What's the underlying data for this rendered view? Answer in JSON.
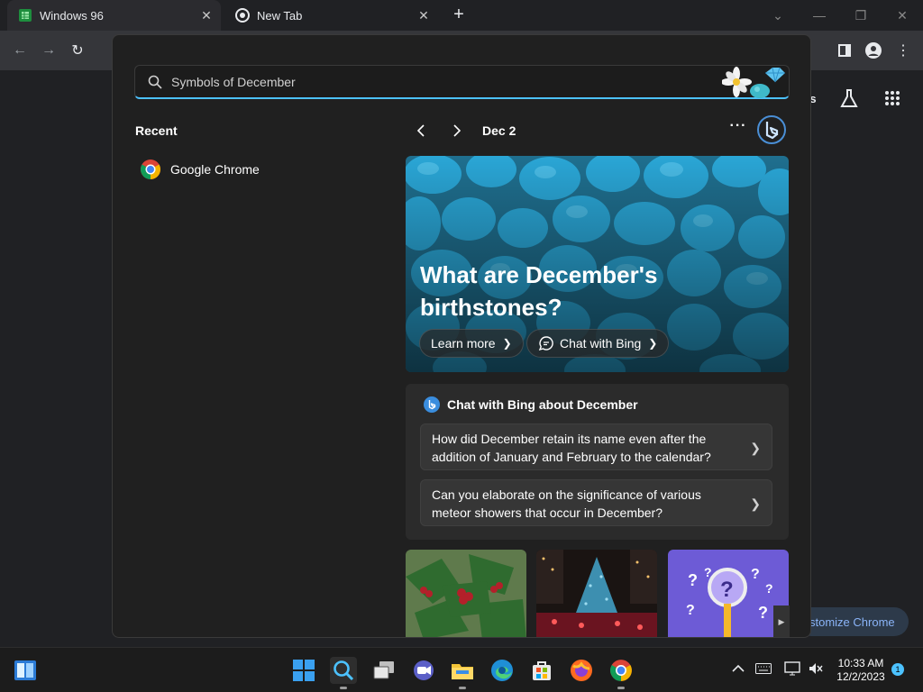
{
  "browser": {
    "tabs": [
      {
        "label": "Windows 96",
        "icon": "sheet-icon"
      },
      {
        "label": "New Tab",
        "icon": "chrome-icon"
      }
    ],
    "new_tab": "+"
  },
  "page": {
    "customize_label": "stomize Chrome",
    "right_text": "s"
  },
  "search": {
    "value": "Symbols of December",
    "recent_heading": "Recent",
    "recent_items": [
      {
        "label": "Google Chrome"
      }
    ],
    "date_label": "Dec 2",
    "more_label": "···",
    "hero": {
      "title": "What are December's birthstones?",
      "learn_more": "Learn more",
      "chat_with_bing": "Chat with Bing"
    },
    "chat": {
      "heading": "Chat with Bing about December",
      "questions": [
        "How did December retain its name even after the addition of January and February to the calendar?",
        "Can you elaborate on the significance of various meteor showers that occur in December?"
      ]
    },
    "accent_color": "#4cc2ff"
  },
  "taskbar": {
    "time": "10:33 AM",
    "date": "12/2/2023",
    "notification_count": "1"
  }
}
